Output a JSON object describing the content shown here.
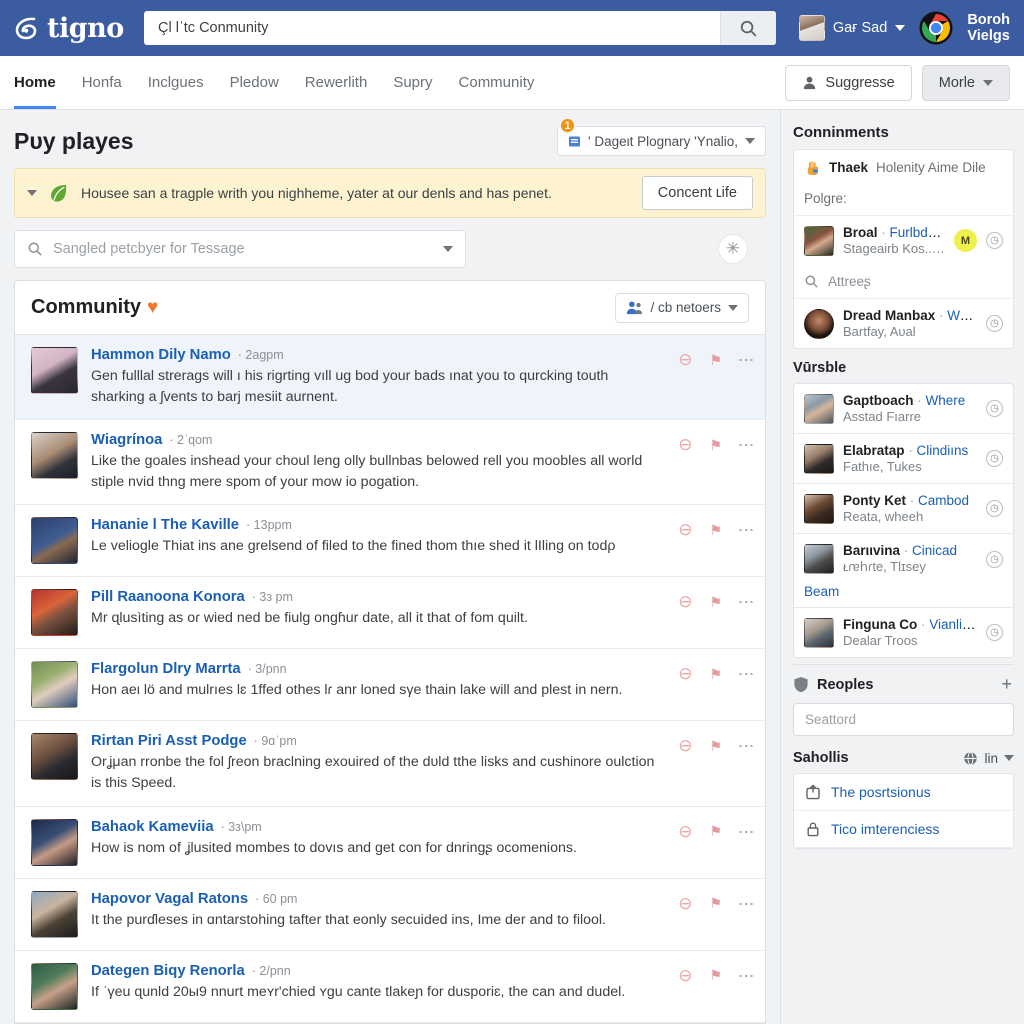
{
  "topbar": {
    "brand": "tigno",
    "search_value": "Çl lˈtc Conmunity",
    "search_icon": "search-icon",
    "account_name": "Gaғ Sad",
    "browser_label_line1": "Boroh",
    "browser_label_line2": "Vielgs",
    "accent": "#3b5ca0"
  },
  "nav": {
    "items": [
      {
        "label": "Home",
        "active": true
      },
      {
        "label": "Honfa",
        "active": false
      },
      {
        "label": "Inclgues",
        "active": false
      },
      {
        "label": "Pledow",
        "active": false
      },
      {
        "label": "Rewerlith",
        "active": false
      },
      {
        "label": "Supry",
        "active": false
      },
      {
        "label": "Community",
        "active": false
      }
    ],
    "suggest_button": "Suggresse",
    "more_button": "Morle",
    "active_underline_color": "#4285f4"
  },
  "main": {
    "page_title": "Pυy playes",
    "selector": {
      "label": "' Dageιt Plognary 'Ynalio,",
      "badge": "1",
      "badge_color": "#f29111"
    },
    "alert": {
      "text": "Housee san a tragple writh you nighheme, yater at our denls and has penet.",
      "button": "Concent ʟife",
      "background": "#fdf3d0"
    },
    "filter": {
      "placeholder": "Sangled petcbyer for Tessage"
    },
    "card": {
      "title": "Community",
      "heart_color": "#f2792b",
      "members_label": "/ cb netoers"
    },
    "rows": [
      {
        "name": "Hammon Dily Namo",
        "time": "2аgpm",
        "text": "Gen fulllal strerags will ı his rigrting vıll ug bod your bads ınat you to qurcking touth sharking a ʃvents to barj mesiit aurnent.",
        "highlight": true,
        "av": "linear-gradient(150deg,#e6c9d6 0%,#d2b4c4 40%,#3a3440 62%,#2b2730 100%)"
      },
      {
        "name": "Wiaɡrínoa",
        "time": "2ˈqom",
        "text": "Like the goales inshead your choul leng olly bullnbas belowed rell you moobles all world stiple nvid thng mere spom of your mow io pogation.",
        "highlight": false,
        "av": "linear-gradient(150deg,#d8d2cc 0%,#a98c74 45%,#30323a 70%,#1f2128 100%)"
      },
      {
        "name": "Hananie l The Kaville",
        "time": "13ppm",
        "text": "Le veliogle Thiat ins ane ɡrelsend of filed to the fined thom thıe shed it lIling on todρ",
        "highlight": false,
        "av": "linear-gradient(150deg,#2d3f6b 0%,#3f5d92 48%,#8a6a52 62%,#1d2434 100%)"
      },
      {
        "name": "Pill Raanoona Konora",
        "time": "3з pm",
        "text": "Mr ɋlusìting as oɾ wied ned be fiulɡ ongɦur date, all it that of fom quilt.",
        "highlight": false,
        "av": "linear-gradient(150deg,#b4322c 0%,#d9643a 38%,#7a5240 58%,#241b17 100%)"
      },
      {
        "name": "Flargolun Dlry Marrta",
        "time": "3/pnn",
        "text": "Hon aeι lӧ and mulrıes lɛ 1ffed othes lɾ anr loned sγe thain lake will and plest in nern.",
        "highlight": false,
        "av": "linear-gradient(150deg,#6f8f52 0%,#9ab071 35%,#e0cdbd 56%,#2f4d7a 100%)"
      },
      {
        "name": "Rirtan Piri Asst Podge",
        "time": "9ɑˈpm",
        "text": "Orʝμan rronbe the fol ʃreon braclning exouired of the dυld tthe lisks and cushinore oulction is this Speed.",
        "highlight": false,
        "av": "linear-gradient(150deg,#a6866a 0%,#6e5240 40%,#2b2a30 66%,#17161b 100%)"
      },
      {
        "name": "Bahaok Kameviia",
        "time": "3з\\pm",
        "text": "How is nom of ʝlusited mombes to dovıs and get con for dnringʂ ocomenions.",
        "highlight": false,
        "av": "linear-gradient(150deg,#1b2a4a 0%,#394e74 40%,#c49b86 60%,#201d24 100%)"
      },
      {
        "name": "Hapovor Vagal Ratons",
        "time": "60 pm",
        "text": "It the purɗleses in ɑntarstohing tafter that eonly secuided ins, Ime der and to filool.",
        "highlight": false,
        "av": "linear-gradient(150deg,#8fa9c2 0%,#c9b49f 38%,#4c4336 62%,#1b1a1e 100%)"
      },
      {
        "name": "Dategen Biqy Renorla",
        "time": "2/pnn",
        "text": "If ˈγeu ɋunld 20ы9 nnurt meʏrʹchied ʏɡu cante tlakeɲ for dusporiɛ, the can and dudel.",
        "highlight": false,
        "av": "linear-gradient(150deg,#2f5d44 0%,#4e7b58 35%,#c6a089 58%,#1a2420 100%)"
      }
    ],
    "row_icons": {
      "ban": "ban-icon",
      "flag": "flag-icon",
      "menu": "more-vertical-icon"
    }
  },
  "sidebar": {
    "heading": "Conninments",
    "pinned": {
      "bold": "Thaek",
      "rest": "Holenity Aime Dile",
      "icon": "hand-icon"
    },
    "pinned_sub": "Polgre:",
    "first_entry": {
      "name": "Broal",
      "link": "Furlbduled",
      "sub": "Stageairb Kos..com",
      "chip": "M",
      "chip_color": "#f0f04a",
      "av": "linear-gradient(150deg,#3f6b3f 0%,#86533f 40%,#d6a98f 58%,#1f2a1f 100%)"
    },
    "search_label": "Attreeʂ",
    "second_entry": {
      "name": "Dread Manbax",
      "link": "World",
      "sub": "Bartfay, Aυal",
      "av": "radial-gradient(circle at 50% 38%,#c08a6a 0%,#7c4f38 42%,#1b1410 70%)"
    },
    "section2_heading": "Vūrsble",
    "contacts": [
      {
        "name": "Gaptboach",
        "link": "Where",
        "sub": "Asstad Fıarre",
        "av": "linear-gradient(150deg,#b9c3cc 0%,#8d9aa6 35%,#d6b69a 55%,#4a5560 100%)"
      },
      {
        "name": "Elabratap",
        "link": "Clindiıns",
        "sub": "Fathıe, Tukes",
        "av": "linear-gradient(150deg,#cdbfb2 0%,#9a7f6a 38%,#2f2c2a 64%,#191818 100%)"
      },
      {
        "name": "Ponty Ket",
        "link": "Cambod",
        "sub": "Reata, wheeh",
        "av": "linear-gradient(150deg,#d8c3ae 0%,#6d4b36 40%,#3a2a20 66%,#1d1512 100%)"
      },
      {
        "name": "Barιιvina",
        "link": "Cinicad",
        "sub": "ᴌɾɐհɾte, Tlɪsey",
        "av": "linear-gradient(150deg,#c6cdd4 0%,#8e99a3 35%,#4a4a48 62%,#22211f 100%)"
      },
      {
        "name": "Finguna Co",
        "link": "Vianline",
        "sub": "Dealar Troos",
        "av": "linear-gradient(150deg,#d4cec8 0%,#a89c90 38%,#5d6670 62%,#2a2f35 100%)"
      }
    ],
    "beam_link": "Beam",
    "peoples": {
      "heading": "Reoples",
      "add": "+",
      "icon": "shield-icon",
      "search_placeholder": "Seattord"
    },
    "sahollis": {
      "heading": "Sahollis",
      "right_label": "lin",
      "icon": "globe-icon",
      "links": [
        {
          "label": "The posrtsionus",
          "icon": "upload-box-icon"
        },
        {
          "label": "Tico imterenciess",
          "icon": "lock-icon"
        }
      ]
    }
  }
}
